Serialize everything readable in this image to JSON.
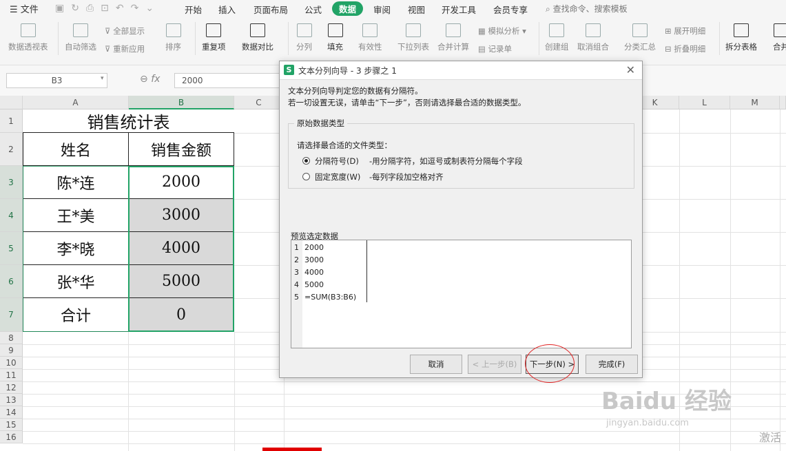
{
  "menubar": {
    "file": "文件",
    "tabs": [
      "开始",
      "插入",
      "页面布局",
      "公式",
      "数据",
      "审阅",
      "视图",
      "开发工具",
      "会员专享"
    ],
    "active_tab": "数据",
    "search": "查找命令、搜索模板"
  },
  "ribbon": {
    "pivot": "数据透视表",
    "autofilter": "自动筛选",
    "show_all": "全部显示",
    "reapply": "重新应用",
    "sort": "排序",
    "duplicates": "重复项",
    "compare": "数据对比",
    "split": "分列",
    "fill": "填充",
    "validity": "有效性",
    "dropdown": "下拉列表",
    "consolidate": "合并计算",
    "simulate": "模拟分析",
    "record": "记录单",
    "group": "创建组",
    "ungroup": "取消组合",
    "subtotal": "分类汇总",
    "expand": "展开明细",
    "collapse": "折叠明细",
    "split_table": "拆分表格",
    "merge": "合并"
  },
  "formula_bar": {
    "name_box": "B3",
    "fx": "fx",
    "value": "2000"
  },
  "columns": [
    "A",
    "B",
    "C",
    "K",
    "L",
    "M"
  ],
  "rows": [
    "1",
    "2",
    "3",
    "4",
    "5",
    "6",
    "7",
    "8",
    "9",
    "10",
    "11",
    "12",
    "13",
    "14",
    "15",
    "16"
  ],
  "table": {
    "title": "销售统计表",
    "headers": [
      "姓名",
      "销售金额"
    ],
    "data": [
      {
        "name": "陈*连",
        "amount": "2000"
      },
      {
        "name": "王*美",
        "amount": "3000"
      },
      {
        "name": "李*晓",
        "amount": "4000"
      },
      {
        "name": "张*华",
        "amount": "5000"
      },
      {
        "name": "合计",
        "amount": "0"
      }
    ]
  },
  "dialog": {
    "title": "文本分列向导 - 3 步骤之 1",
    "line1": "文本分列向导判定您的数据有分隔符。",
    "line2": "若一切设置无误，请单击“下一步”，否则请选择最合适的数据类型。",
    "group_title": "原始数据类型",
    "choose_label": "请选择最合适的文件类型：",
    "option1": "分隔符号(D)",
    "option1_desc": "-用分隔字符，如逗号或制表符分隔每个字段",
    "option2": "固定宽度(W)",
    "option2_desc": "-每列字段加空格对齐",
    "preview_label": "预览选定数据",
    "preview_rows": [
      "2000",
      "3000",
      "4000",
      "5000",
      "=SUM(B3:B6)"
    ],
    "preview_nums": [
      "1",
      "2",
      "3",
      "4",
      "5"
    ],
    "btn_cancel": "取消",
    "btn_back": "< 上一步(B)",
    "btn_next": "下一步(N) >",
    "btn_finish": "完成(F)"
  },
  "watermark": {
    "brand": "Baidu 经验",
    "url": "jingyan.baidu.com"
  },
  "activate": "激活"
}
